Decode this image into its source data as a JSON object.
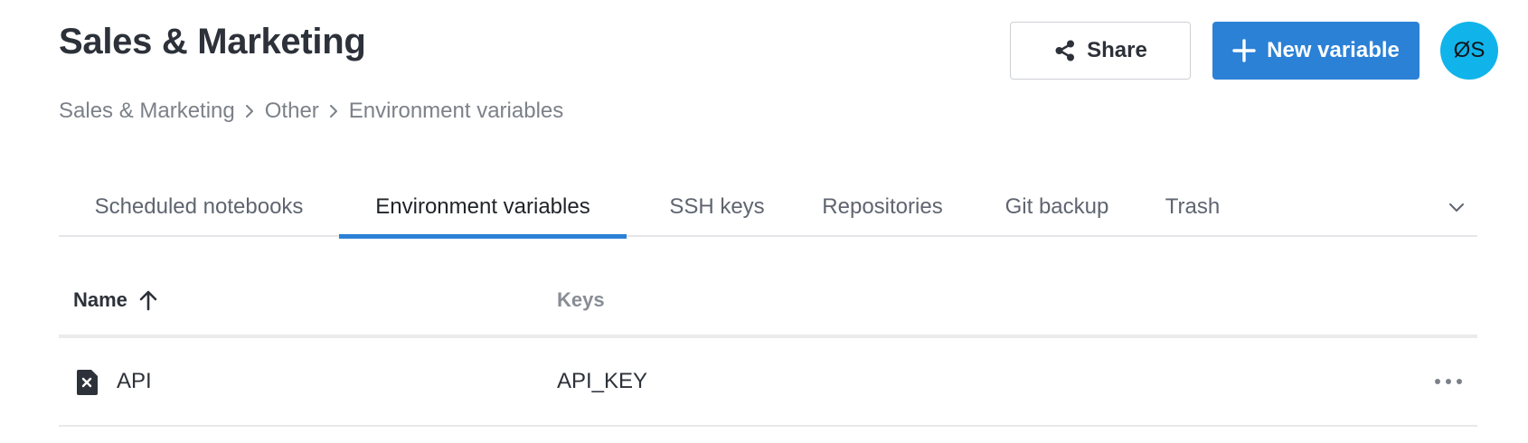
{
  "header": {
    "title": "Sales & Marketing",
    "share_label": "Share",
    "new_variable_label": "New variable",
    "avatar_initials": "ØS"
  },
  "breadcrumb": [
    "Sales & Marketing",
    "Other",
    "Environment variables"
  ],
  "tabs": [
    {
      "label": "Scheduled notebooks",
      "active": false
    },
    {
      "label": "Environment variables",
      "active": true
    },
    {
      "label": "SSH keys",
      "active": false
    },
    {
      "label": "Repositories",
      "active": false
    },
    {
      "label": "Git backup",
      "active": false
    },
    {
      "label": "Trash",
      "active": false
    }
  ],
  "table": {
    "columns": [
      {
        "label": "Name",
        "sort": "ascending"
      },
      {
        "label": "Keys"
      }
    ],
    "rows": [
      {
        "icon": "variable-file-icon",
        "name": "API",
        "keys": "API_KEY"
      }
    ]
  },
  "icons": {
    "share": "share-icon",
    "new_variable": "plus-icon",
    "breadcrumb_separator": "chevron-right-icon",
    "tabs_more": "chevron-down-icon",
    "sort": "arrow-up-icon",
    "row_actions": "more-horizontal-icon"
  },
  "colors": {
    "accent": "#2b81d6",
    "avatar": "#10b4ea",
    "text": "#2d3139",
    "muted_text": "#7c8189"
  }
}
